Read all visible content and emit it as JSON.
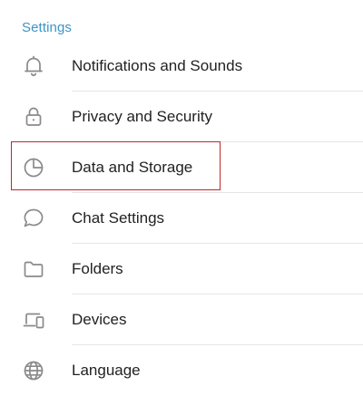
{
  "section_title": "Settings",
  "menu": {
    "items": [
      {
        "label": "Notifications and Sounds",
        "icon": "bell-icon"
      },
      {
        "label": "Privacy and Security",
        "icon": "lock-icon"
      },
      {
        "label": "Data and Storage",
        "icon": "pie-chart-icon",
        "highlighted": true
      },
      {
        "label": "Chat Settings",
        "icon": "chat-bubble-icon"
      },
      {
        "label": "Folders",
        "icon": "folder-icon"
      },
      {
        "label": "Devices",
        "icon": "devices-icon"
      },
      {
        "label": "Language",
        "icon": "globe-icon"
      }
    ]
  },
  "colors": {
    "accent": "#3a95c8",
    "highlight": "#c0262d",
    "icon": "#8a8a8a",
    "text": "#222222"
  }
}
